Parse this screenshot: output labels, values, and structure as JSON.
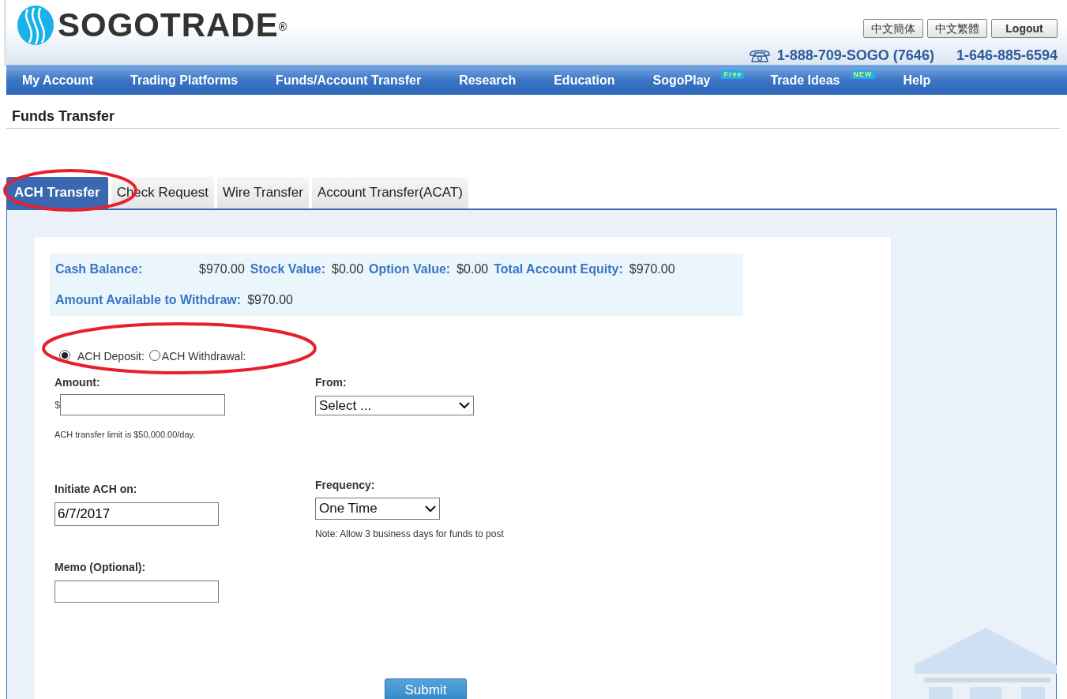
{
  "header": {
    "logo": "SOGOTRADE$^{®}$",
    "language_buttons": [
      "中文簡体",
      "中文繁體"
    ],
    "logout": "Logout",
    "phones": [
      "1-888-709-SOGO (7646)",
      "1-646-885-6594"
    ]
  },
  "nav": [
    {
      "label": "My Account"
    },
    {
      "label": "Trading Platforms"
    },
    {
      "label": "Funds/Account Transfer"
    },
    {
      "label": "Research"
    },
    {
      "label": "Education"
    },
    {
      "label": "SogoPlay",
      "badge": "Free"
    },
    {
      "label": "Trade Ideas",
      "badge": "NEW"
    },
    {
      "label": "Help"
    }
  ],
  "page_title": "Funds Transfer",
  "tabs": [
    {
      "label": "ACH Transfer",
      "selected": true
    },
    {
      "label": "Check Request",
      "selected": false
    },
    {
      "label": "Wire Transfer",
      "selected": false
    },
    {
      "label": "Account Transfer(ACAT)",
      "selected": false
    }
  ],
  "balances": [
    {
      "label": "Cash Balance:",
      "value": "$970.00"
    },
    {
      "label": "Stock Value:",
      "value": "$0.00"
    },
    {
      "label": "Option Value:",
      "value": "$0.00"
    },
    {
      "label": "Total Account Equity:",
      "value": "$970.00"
    },
    {
      "label": "Amount Available to Withdraw:",
      "value": "$970.00"
    }
  ],
  "direction": [
    {
      "label": "ACH Deposit:",
      "selected": true
    },
    {
      "label": "ACH Withdrawal:",
      "selected": false
    }
  ],
  "amount": {
    "label": "Amount:",
    "currency": "$",
    "note": "ACH transfer limit is $50,000.00/day."
  },
  "from": {
    "label": "From:",
    "value": "Select ..."
  },
  "initiate": {
    "label": "Initiate ACH on:",
    "value": "6/7/2017"
  },
  "frequency": {
    "label": "Frequency:",
    "value": "One Time",
    "note": "Note: Allow 3 business days for funds to post"
  },
  "memo": {
    "label": "Memo (Optional):"
  },
  "submit": "Submit"
}
